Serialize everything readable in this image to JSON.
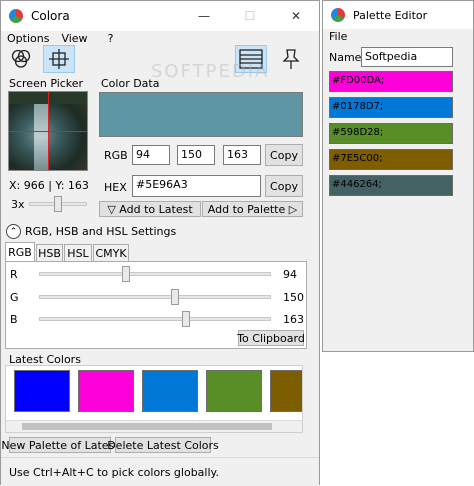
{
  "main_window": {
    "title": "Colora",
    "controls": {
      "minimize": "—",
      "maximize": "☐",
      "close": "✕"
    },
    "menu": [
      "Options",
      "View",
      "?"
    ]
  },
  "toolbar": {
    "left_buttons": [
      "color-mixer-icon",
      "crosshair-icon"
    ],
    "right_buttons": [
      "palette-list-icon",
      "pin-icon"
    ]
  },
  "screen_picker": {
    "title": "Screen Picker",
    "coords": "X: 966 | Y: 163",
    "zoom": "3x",
    "zoom_level_fraction": 0.5
  },
  "color_data": {
    "title": "Color Data",
    "preview_color": "#5E96A3",
    "rgb_label": "RGB",
    "r": "94",
    "g": "150",
    "b": "163",
    "copy_label": "Copy",
    "hex_label": "HEX",
    "hex_value": "#5E96A3",
    "add_latest": "▽ Add to Latest",
    "add_palette": "Add to Palette ▷"
  },
  "settings": {
    "title": "RGB, HSB and HSL Settings",
    "tabs": [
      "RGB",
      "HSB",
      "HSL",
      "CMYK"
    ],
    "sliders": [
      {
        "label": "R",
        "value": "94",
        "fraction": 0.369
      },
      {
        "label": "G",
        "value": "150",
        "fraction": 0.588
      },
      {
        "label": "B",
        "value": "163",
        "fraction": 0.639
      }
    ],
    "clipboard": "To Clipboard"
  },
  "latest": {
    "title": "Latest Colors",
    "colors": [
      "#0000FF",
      "#FD00DA",
      "#0178D7",
      "#598D28",
      "#7E5C00"
    ],
    "new_palette": "New Palette of Latest",
    "delete": "Delete Latest Colors"
  },
  "status": "Use Ctrl+Alt+C to pick colors globally.",
  "watermark": "SOFTPEDIA",
  "palette_editor": {
    "title": "Palette Editor",
    "menu": [
      "File"
    ],
    "name_label": "Name:",
    "name_value": "Softpedia",
    "items": [
      {
        "text": "#FD00DA;",
        "color": "#FD00DA"
      },
      {
        "text": "#0178D7;",
        "color": "#0178D7"
      },
      {
        "text": "#598D28;",
        "color": "#598D28"
      },
      {
        "text": "#7E5C00;",
        "color": "#7E5C00"
      },
      {
        "text": "#446264;",
        "color": "#446264"
      }
    ]
  }
}
